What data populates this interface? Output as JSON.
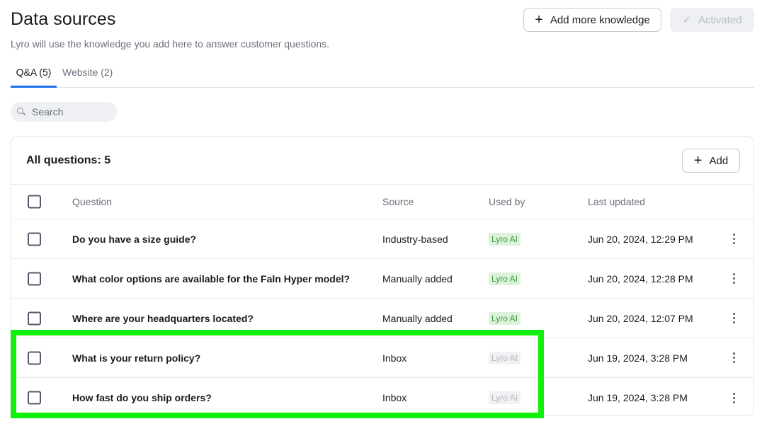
{
  "header": {
    "title": "Data sources",
    "subtitle": "Lyro will use the knowledge you add here to answer customer questions.",
    "add_knowledge_label": "Add more knowledge",
    "activated_label": "Activated"
  },
  "tabs": [
    {
      "label": "Q&A (5)",
      "active": true
    },
    {
      "label": "Website (2)",
      "active": false
    }
  ],
  "search": {
    "placeholder": "Search",
    "value": ""
  },
  "table": {
    "title": "All questions: 5",
    "add_label": "Add",
    "columns": [
      "Question",
      "Source",
      "Used by",
      "Last updated"
    ],
    "rows": [
      {
        "question": "Do you have a size guide?",
        "source": "Industry-based",
        "used_by": "Lyro AI",
        "used_by_active": true,
        "last_updated": "Jun 20, 2024, 12:29 PM"
      },
      {
        "question": "What color options are available for the Faln Hyper model?",
        "source": "Manually added",
        "used_by": "Lyro AI",
        "used_by_active": true,
        "last_updated": "Jun 20, 2024, 12:28 PM"
      },
      {
        "question": "Where are your headquarters located?",
        "source": "Manually added",
        "used_by": "Lyro AI",
        "used_by_active": true,
        "last_updated": "Jun 20, 2024, 12:07 PM"
      },
      {
        "question": "What is your return policy?",
        "source": "Inbox",
        "used_by": "Lyro AI",
        "used_by_active": false,
        "last_updated": "Jun 19, 2024, 3:28 PM"
      },
      {
        "question": "How fast do you ship orders?",
        "source": "Inbox",
        "used_by": "Lyro AI",
        "used_by_active": false,
        "last_updated": "Jun 19, 2024, 3:28 PM"
      }
    ]
  },
  "icons": {
    "add": "plus-icon",
    "activated": "check-icon",
    "search": "search-icon",
    "row_menu": "more-vertical-icon"
  },
  "colors": {
    "accent": "#1f6feb",
    "badge_active_bg": "#ddf2dc",
    "badge_active_text": "#3c9a3c",
    "highlight": "#11f00a"
  }
}
